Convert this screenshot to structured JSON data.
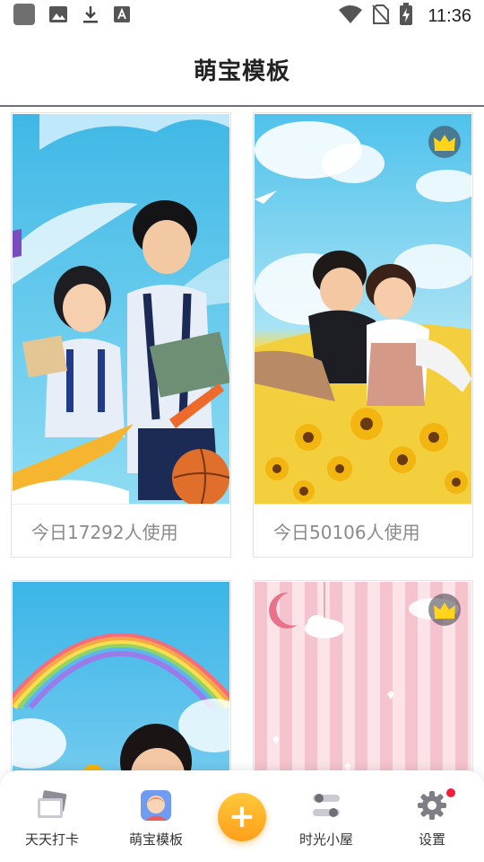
{
  "status_bar": {
    "time": "11:36",
    "left_icons": [
      "app-square-icon",
      "image-icon",
      "download-icon",
      "font-a-icon"
    ],
    "right_icons": [
      "wifi-icon",
      "no-sim-icon",
      "battery-charging-icon"
    ]
  },
  "header": {
    "title": "萌宝模板"
  },
  "templates": [
    {
      "caption": "今日17292人使用",
      "premium": false,
      "theme": "school-sky"
    },
    {
      "caption": "今日50106人使用",
      "premium": true,
      "theme": "sunflower-sky"
    },
    {
      "caption": "",
      "premium": false,
      "theme": "rainbow-sky"
    },
    {
      "caption": "",
      "premium": true,
      "theme": "pink-stripes"
    }
  ],
  "bottom_nav": {
    "items": [
      {
        "label": "天天打卡",
        "icon": "photo-cards-icon"
      },
      {
        "label": "萌宝模板",
        "icon": "baby-avatar-icon",
        "active": true
      },
      {
        "label": "",
        "icon": "plus-icon"
      },
      {
        "label": "时光小屋",
        "icon": "sliders-icon"
      },
      {
        "label": "设置",
        "icon": "gear-icon",
        "badge": true
      }
    ],
    "fab_symbol": "+"
  },
  "colors": {
    "accent": "#ffb22a",
    "badge": "#f0203a",
    "divider": "#6b6f7e"
  }
}
